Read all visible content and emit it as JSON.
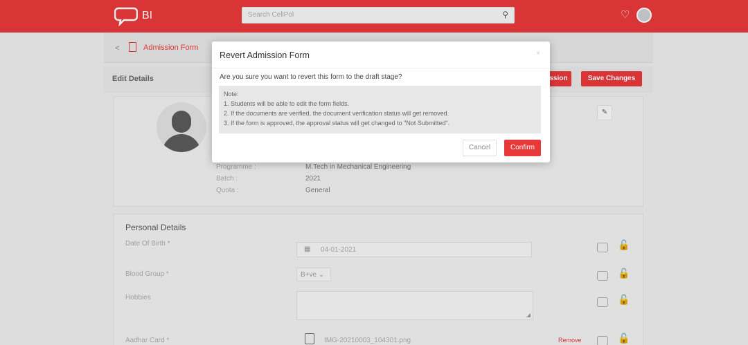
{
  "header": {
    "logo_text": "BI",
    "search_placeholder": "Search CellPol",
    "brand_color": "#e8393a"
  },
  "breadcrumb": {
    "label": "Admission Form"
  },
  "edit_section": {
    "title": "Edit Details",
    "submit_label_partial": "ission",
    "save_label": "Save Changes"
  },
  "profile": {
    "fields": [
      {
        "label": "Programme :",
        "value": "M.Tech in Mechanical Engineering"
      },
      {
        "label": "Batch :",
        "value": "2021"
      },
      {
        "label": "Quota :",
        "value": "General"
      }
    ]
  },
  "personal": {
    "title": "Personal Details",
    "dob_label": "Date Of Birth *",
    "dob_value": "04-01-2021",
    "blood_label": "Blood Group *",
    "blood_value": "B+ve",
    "hobbies_label": "Hobbies",
    "aadhar_label": "Aadhar Card *",
    "aadhar_file": "IMG-20210003_104301.png",
    "remove_label": "Remove"
  },
  "modal": {
    "title": "Revert Admission Form",
    "close": "×",
    "question": "Are you sure you want to revert this form to the draft stage?",
    "note_heading": "Note:",
    "notes": [
      "1. Students will be able to edit the form fields.",
      "2. If the documents are verified, the document verification status will get removed.",
      "3. If the form is approved, the approval status will get changed to \"Not Submitted\"."
    ],
    "cancel_label": "Cancel",
    "confirm_label": "Confirm"
  }
}
